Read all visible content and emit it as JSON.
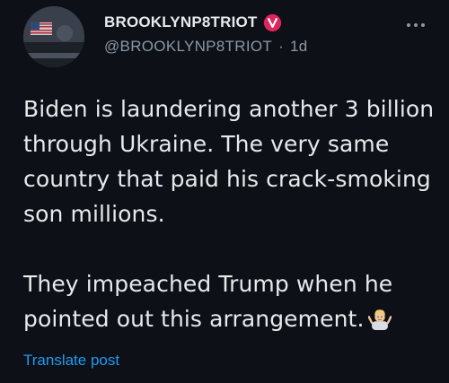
{
  "user": {
    "display_name": "BROOKLYNP8TRIOT",
    "handle": "@BROOKLYNP8TRIOT",
    "separator": "·",
    "timestamp": "1d",
    "verified_icon": "verified-badge-icon"
  },
  "tweet": {
    "paragraph_1": "Biden is laundering another 3 billion through Ukraine. The very same country that paid his crack-smoking son millions.",
    "paragraph_2": "They impeached Trump when he pointed out this arrangement.",
    "emoji": "shrug-emoji"
  },
  "actions": {
    "translate_label": "Translate post",
    "more_icon": "more-options-icon"
  },
  "colors": {
    "background": "#0d1017",
    "text": "#e7e9ea",
    "secondary_text": "#8b98a5",
    "link": "#1d9bf0",
    "verified": "#e0245e"
  }
}
